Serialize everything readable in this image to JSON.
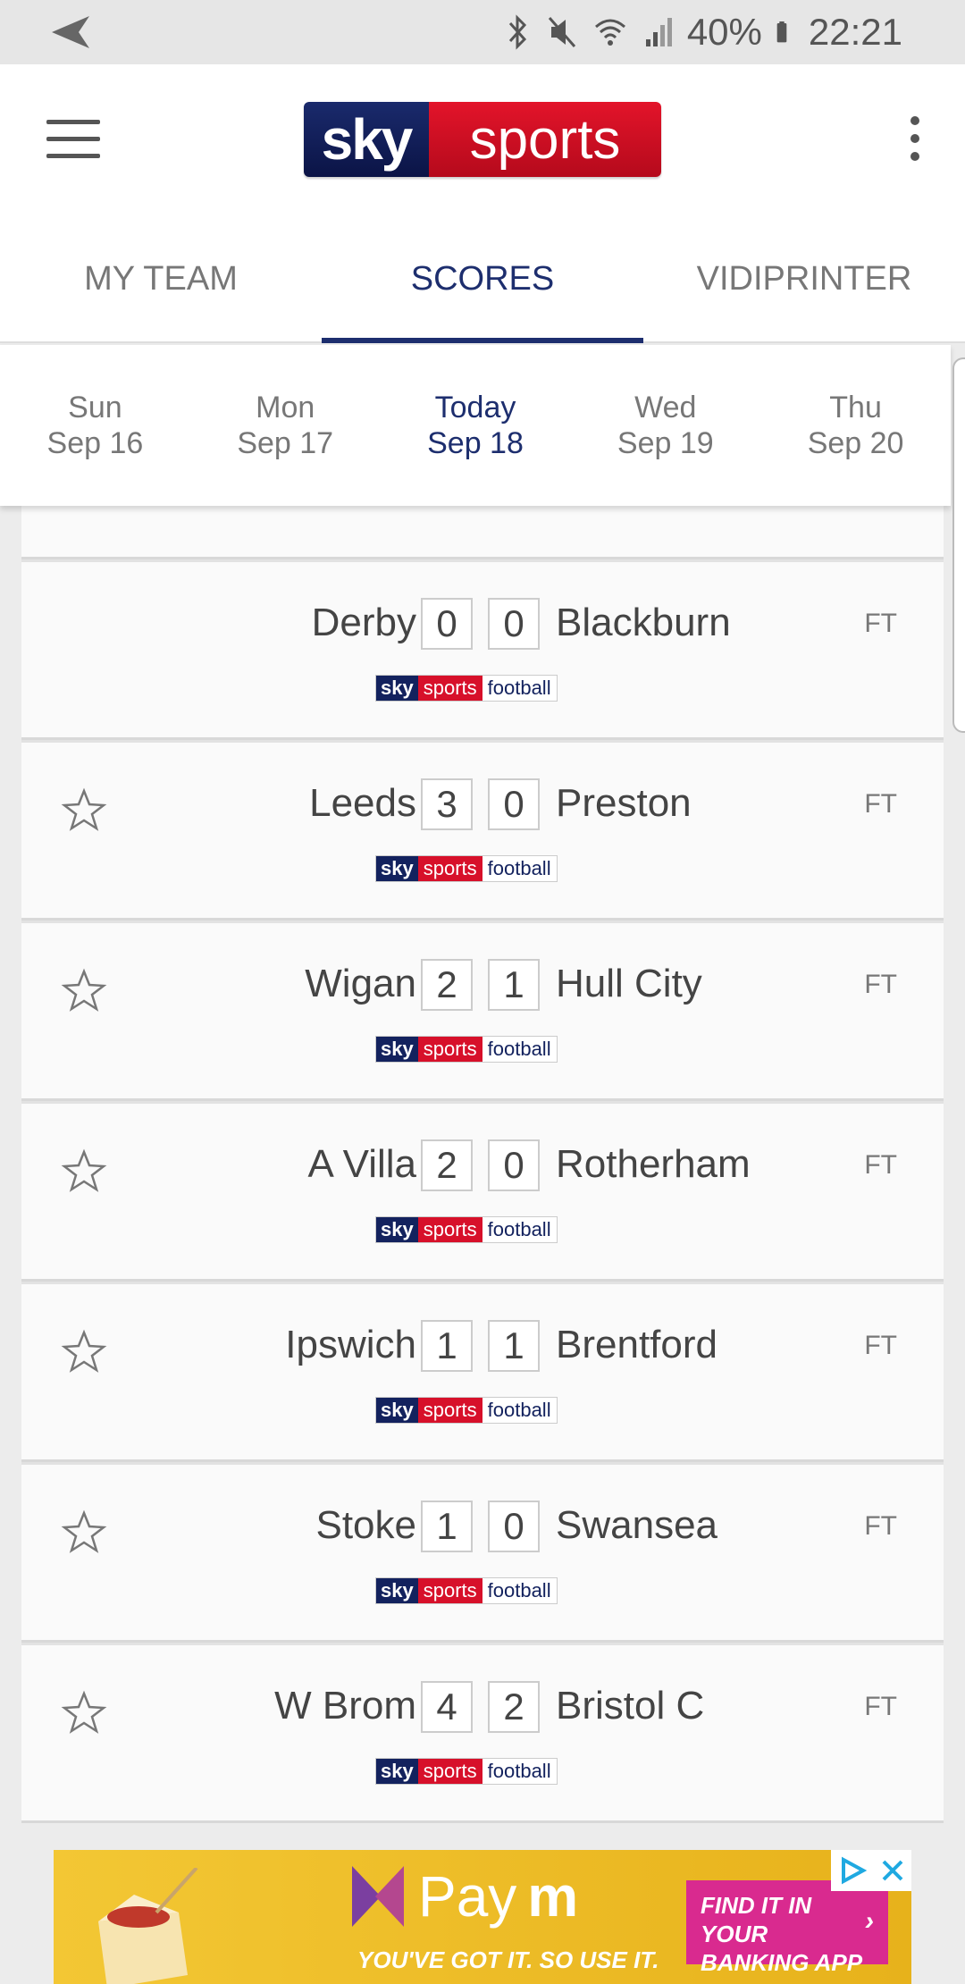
{
  "status_bar": {
    "battery": "40%",
    "time": "22:21"
  },
  "header": {
    "logo_sky": "sky",
    "logo_sports": "sports"
  },
  "tabs": [
    {
      "label": "MY TEAM",
      "active": false
    },
    {
      "label": "SCORES",
      "active": true
    },
    {
      "label": "VIDIPRINTER",
      "active": false
    }
  ],
  "dates": [
    {
      "day": "Sun",
      "date": "Sep 16"
    },
    {
      "day": "Mon",
      "date": "Sep 17"
    },
    {
      "day": "Today",
      "date": "Sep 18"
    },
    {
      "day": "Wed",
      "date": "Sep 19"
    },
    {
      "day": "Thu",
      "date": "Sep 20"
    }
  ],
  "channel": {
    "sky": "sky",
    "sports": "sports",
    "football": "football"
  },
  "matches": [
    {
      "home": "Derby",
      "home_score": "0",
      "away_score": "0",
      "away": "Blackburn",
      "status": "FT",
      "starred_visible": false
    },
    {
      "home": "Leeds",
      "home_score": "3",
      "away_score": "0",
      "away": "Preston",
      "status": "FT",
      "starred_visible": true
    },
    {
      "home": "Wigan",
      "home_score": "2",
      "away_score": "1",
      "away": "Hull City",
      "status": "FT",
      "starred_visible": true
    },
    {
      "home": "A Villa",
      "home_score": "2",
      "away_score": "0",
      "away": "Rotherham",
      "status": "FT",
      "starred_visible": true
    },
    {
      "home": "Ipswich",
      "home_score": "1",
      "away_score": "1",
      "away": "Brentford",
      "status": "FT",
      "starred_visible": true
    },
    {
      "home": "Stoke",
      "home_score": "1",
      "away_score": "0",
      "away": "Swansea",
      "status": "FT",
      "starred_visible": true
    },
    {
      "home": "W Brom",
      "home_score": "4",
      "away_score": "2",
      "away": "Bristol C",
      "status": "FT",
      "starred_visible": true
    }
  ],
  "ad": {
    "brand_pay": "Pay",
    "brand_m": "m",
    "tagline": "YOU'VE GOT IT. SO USE IT.",
    "cta_line1": "FIND IT IN YOUR",
    "cta_line2": "BANKING APP",
    "cta_chevron": "›"
  },
  "colors": {
    "brand_navy": "#1d2e6e",
    "brand_red": "#d7102a",
    "ad_yellow": "#f3c734",
    "ad_pink": "#d92a8f"
  }
}
